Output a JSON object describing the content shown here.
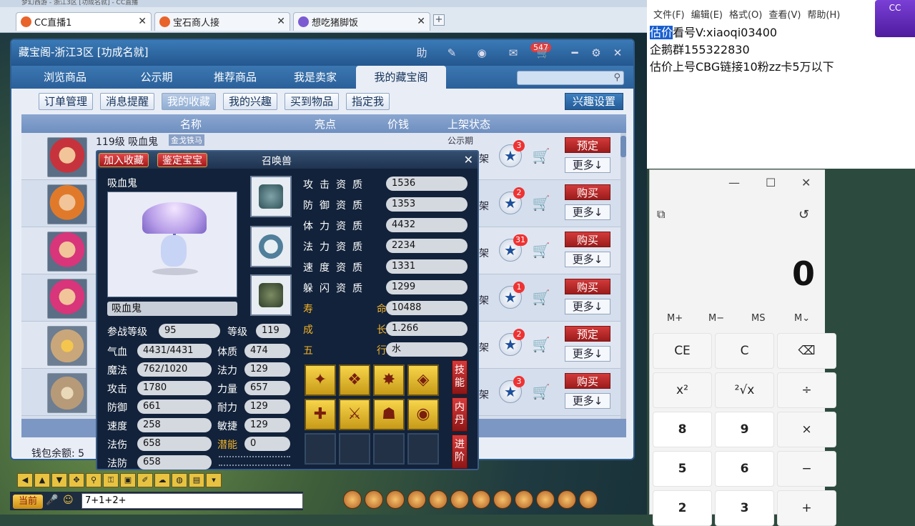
{
  "top_strip": "梦幻西游 - 浙江3区 [功成名就] - CC直播",
  "tabs": [
    {
      "label": "CC直播1",
      "color": "#e8642b"
    },
    {
      "label": "宝石商人接",
      "color": "#e8642b"
    },
    {
      "label": "想吃猪脚饭",
      "color": "#7b5bd2"
    }
  ],
  "new_tab": "+",
  "cbg": {
    "title": "藏宝阁-浙江3区 [功成名就]",
    "help": "助",
    "mail_count": "547",
    "nav": [
      "浏览商品",
      "公示期",
      "推荐商品",
      "我是卖家",
      "我的藏宝阁"
    ],
    "sub": [
      "订单管理",
      "消息提醒",
      "我的收藏",
      "我的兴趣",
      "买到物品",
      "指定我"
    ],
    "interest_settings": "兴趣设置",
    "columns": [
      "名称",
      "亮点",
      "价钱",
      "上架状态"
    ],
    "row_title": "119级 吸血鬼",
    "row_tag": "金戈铁马",
    "row_top": "公示期",
    "rows": [
      {
        "status": "架",
        "fav": "3",
        "action": "预定",
        "more": "更多↓"
      },
      {
        "status": "架",
        "fav": "2",
        "action": "购买",
        "more": "更多↓"
      },
      {
        "status": "架",
        "fav": "31",
        "action": "购买",
        "more": "更多↓"
      },
      {
        "status": "架",
        "fav": "1",
        "action": "购买",
        "more": "更多↓"
      },
      {
        "status": "架",
        "fav": "2",
        "action": "预定",
        "more": "更多↓"
      },
      {
        "status": "架",
        "fav": "3",
        "action": "购买",
        "more": "更多↓"
      }
    ],
    "wallet": "钱包余额: 5"
  },
  "pet": {
    "title": "召唤兽",
    "add_fav": "加入收藏",
    "appraise": "鉴定宝宝",
    "name": "吸血鬼",
    "name_box": "吸血鬼",
    "aptitudes": [
      {
        "label": "攻击资质",
        "value": "1536"
      },
      {
        "label": "防御资质",
        "value": "1353"
      },
      {
        "label": "体力资质",
        "value": "4432"
      },
      {
        "label": "法力资质",
        "value": "2234"
      },
      {
        "label": "速度资质",
        "value": "1331"
      },
      {
        "label": "躲闪资质",
        "value": "1299"
      }
    ],
    "life_label": "寿  命",
    "life": "10488",
    "growth_label": "成  长",
    "growth": "1.266",
    "element_label": "五  行",
    "element": "水",
    "battle_level_label": "参战等级",
    "battle_level": "95",
    "level_label": "等级",
    "level": "119",
    "stats_left": [
      {
        "label": "气血",
        "value": "4431/4431"
      },
      {
        "label": "魔法",
        "value": "762/1020"
      },
      {
        "label": "攻击",
        "value": "1780"
      },
      {
        "label": "防御",
        "value": "661"
      },
      {
        "label": "速度",
        "value": "258"
      },
      {
        "label": "法伤",
        "value": "658"
      },
      {
        "label": "法防",
        "value": "658"
      }
    ],
    "stats_right": [
      {
        "label": "体质",
        "value": "474"
      },
      {
        "label": "法力",
        "value": "129"
      },
      {
        "label": "力量",
        "value": "657"
      },
      {
        "label": "耐力",
        "value": "129"
      },
      {
        "label": "敏捷",
        "value": "129"
      },
      {
        "label": "潜能",
        "value": "0"
      }
    ],
    "side_tabs": [
      "技能",
      "内丹",
      "进阶"
    ]
  },
  "chat": {
    "channel": "当前",
    "input": "7+1+2+"
  },
  "notepad": {
    "menu": [
      "文件(F)",
      "编辑(E)",
      "格式(O)",
      "查看(V)",
      "帮助(H)"
    ],
    "line1_sel": "估价",
    "line1_rest": "看号V:xiaoqi03400",
    "line2": "企鹅群155322830",
    "line3": "估价上号CBG链接10粉zz卡5万以下"
  },
  "calc": {
    "display": "0",
    "memory": [
      "M+",
      "M−",
      "MS",
      "M⌄"
    ],
    "keys": [
      {
        "label": "CE",
        "row": 0,
        "col": 0,
        "kind": "op"
      },
      {
        "label": "C",
        "row": 0,
        "col": 1,
        "kind": "op"
      },
      {
        "label": "⌫",
        "row": 0,
        "col": 2,
        "kind": "op"
      },
      {
        "label": "x²",
        "row": 1,
        "col": 0,
        "kind": "op"
      },
      {
        "label": "²√x",
        "row": 1,
        "col": 1,
        "kind": "op"
      },
      {
        "label": "÷",
        "row": 1,
        "col": 2,
        "kind": "op"
      },
      {
        "label": "8",
        "row": 2,
        "col": 0,
        "kind": "num"
      },
      {
        "label": "9",
        "row": 2,
        "col": 1,
        "kind": "num"
      },
      {
        "label": "×",
        "row": 2,
        "col": 2,
        "kind": "op"
      },
      {
        "label": "5",
        "row": 3,
        "col": 0,
        "kind": "num"
      },
      {
        "label": "6",
        "row": 3,
        "col": 1,
        "kind": "num"
      },
      {
        "label": "−",
        "row": 3,
        "col": 2,
        "kind": "op"
      },
      {
        "label": "2",
        "row": 4,
        "col": 0,
        "kind": "num"
      },
      {
        "label": "3",
        "row": 4,
        "col": 1,
        "kind": "num"
      },
      {
        "label": "+",
        "row": 4,
        "col": 2,
        "kind": "op"
      }
    ]
  }
}
